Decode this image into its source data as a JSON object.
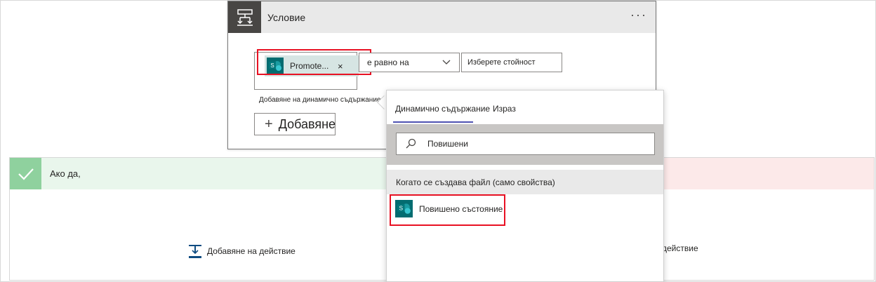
{
  "condition": {
    "title": "Условие",
    "more": "···",
    "token_label": "Promote...",
    "token_remove": "×",
    "operator": "е равно на",
    "value_placeholder": "Изберете стойност",
    "dynamic_link": "Добавяне на динамично съдържание",
    "dynamic_plus": "+",
    "add_plus": "+",
    "add_label": "Добавяне"
  },
  "branch_yes": {
    "title": "Ако да,",
    "add_action": "Добавяне на действие"
  },
  "branch_no": {
    "add_action": "действие"
  },
  "flyout": {
    "tabs": [
      {
        "label": "Динамично съдържание"
      },
      {
        "label": "Израз"
      }
    ],
    "search_value": "Повишени",
    "section": "Когато се създава файл (само свойства)",
    "result_label": "Повишено състояние"
  },
  "colors": {
    "accent": "#4f52b2",
    "highlight": "#e81123",
    "sharepoint": "#036c70",
    "yes_bg": "#e9f6ec",
    "no_bg": "#fce9e9"
  }
}
